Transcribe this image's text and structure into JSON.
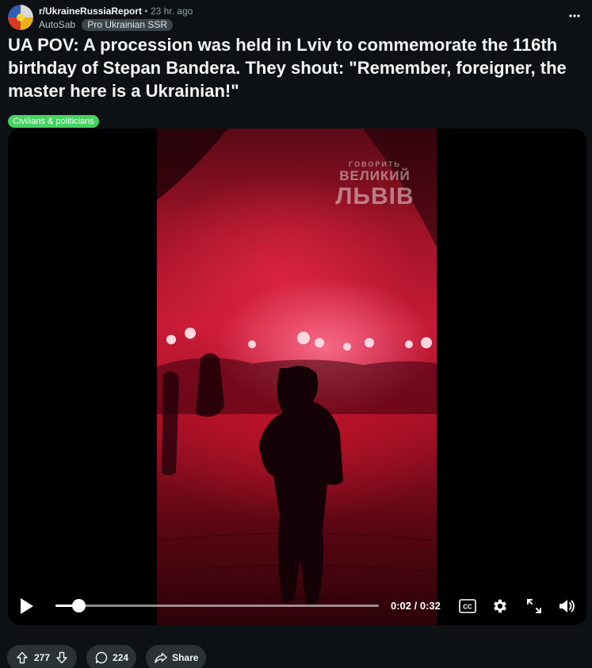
{
  "post": {
    "subreddit": "r/UkraineRussiaReport",
    "separator": "•",
    "age": "23 hr. ago",
    "author": "AutoSab",
    "user_flair": "Pro Ukrainian SSR",
    "title": "UA POV: A procession was held in Lviv to commemorate the 116th birthday of Stepan Bandera. They shout: \"Remember, foreigner, the master here is a Ukrainian!\"",
    "post_flair": "Civilians & politicians",
    "post_flair_color": "#46d160"
  },
  "video": {
    "watermark": {
      "line1": "ГОВОРИТЬ",
      "line2": "ВЕЛИКИЙ",
      "line3": "ЛЬВІВ"
    },
    "current_time": "0:02",
    "time_separator": " / ",
    "duration": "0:32",
    "progress_fraction": 0.07,
    "icons": [
      "play-icon",
      "captions-icon",
      "settings-icon",
      "fullscreen-icon",
      "volume-icon"
    ]
  },
  "actions": {
    "upvotes": "277",
    "comments": "224",
    "share_label": "Share"
  },
  "colors": {
    "background": "#0e1113",
    "pill_bg": "#2a3236",
    "user_flair_bg": "#3b4449"
  }
}
